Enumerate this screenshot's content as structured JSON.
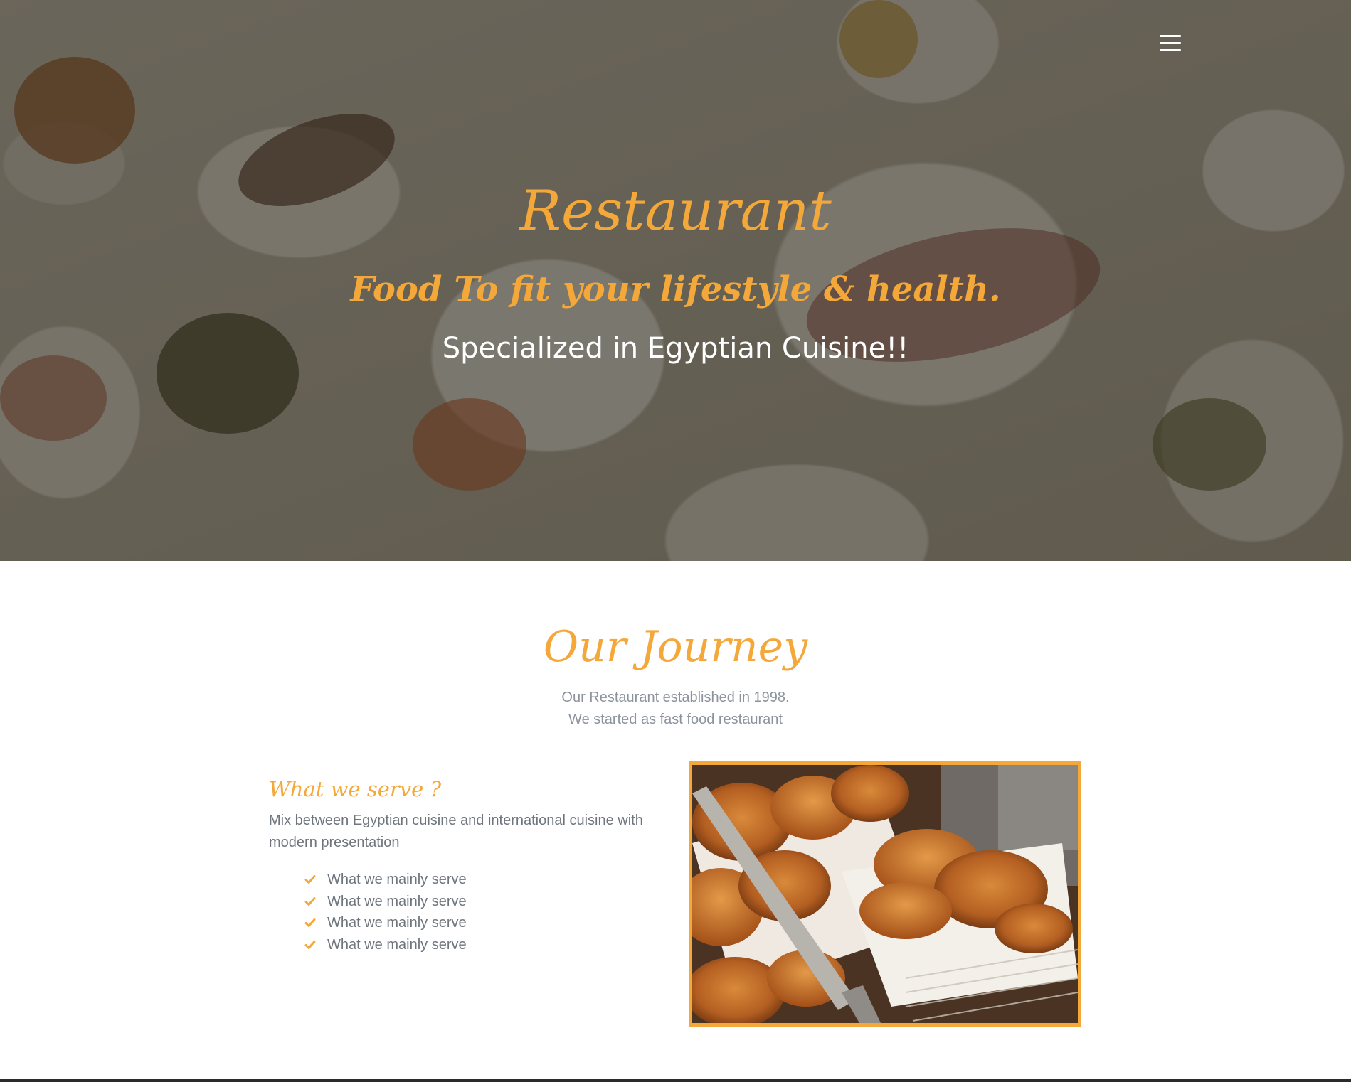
{
  "nav": {
    "menu_icon": "hamburger-menu-icon"
  },
  "hero": {
    "title": "Restaurant",
    "tagline": "Food To fit your lifestyle & health.",
    "subtitle": "Specialized in Egyptian Cuisine!!"
  },
  "journey": {
    "title": "Our Journey",
    "lines": [
      "Our Restaurant established in 1998.",
      "We started as fast food restaurant"
    ]
  },
  "serve": {
    "title": "What we serve ?",
    "description": "Mix between Egyptian cuisine and international cuisine with modern presentation",
    "items": [
      "What we mainly serve",
      "What we mainly serve",
      "What we mainly serve",
      "What we mainly serve"
    ],
    "item_icon": "check-icon"
  },
  "colors": {
    "accent": "#f4a83a",
    "body_text": "#6e757d",
    "muted_text": "#8c939c"
  }
}
